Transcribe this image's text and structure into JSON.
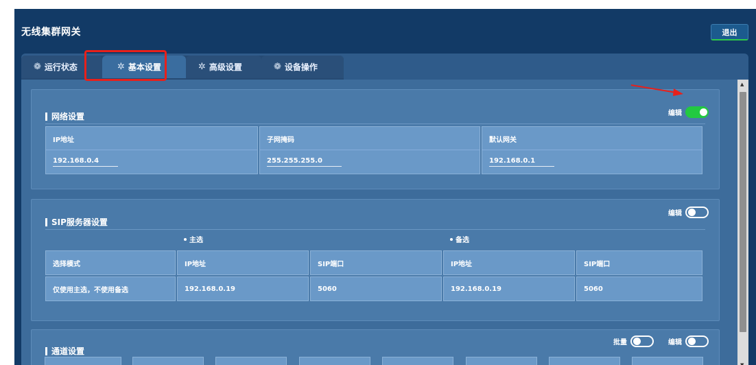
{
  "app": {
    "title": "无线集群网关",
    "logout_label": "退出"
  },
  "tabs": [
    {
      "label": "运行状态",
      "icon": "gear-icon"
    },
    {
      "label": "基本设置",
      "icon": "asterisk-icon",
      "active": true
    },
    {
      "label": "高级设置",
      "icon": "asterisk-icon"
    },
    {
      "label": "设备操作",
      "icon": "gear-icon"
    }
  ],
  "network": {
    "title": "网络设置",
    "edit_label": "编辑",
    "edit_on": true,
    "ip_label": "IP地址",
    "ip_value": "192.168.0.4",
    "mask_label": "子网掩码",
    "mask_value": "255.255.255.0",
    "gateway_label": "默认网关",
    "gateway_value": "192.168.0.1"
  },
  "sip": {
    "title": "SIP服务器设置",
    "edit_label": "编辑",
    "edit_on": false,
    "primary_label": "主选",
    "backup_label": "备选",
    "mode_label": "选择模式",
    "mode_value": "仅使用主选，不使用备选",
    "primary_ip_label": "IP地址",
    "primary_ip_value": "192.168.0.19",
    "primary_port_label": "SIP端口",
    "primary_port_value": "5060",
    "backup_ip_label": "IP地址",
    "backup_ip_value": "192.168.0.19",
    "backup_port_label": "SIP端口",
    "backup_port_value": "5060"
  },
  "channel": {
    "title": "通道设置",
    "batch_label": "批量",
    "batch_on": false,
    "edit_label": "编辑",
    "edit_on": false
  },
  "colors": {
    "accent_green": "#22c940",
    "annotation_red": "#e8201a",
    "bg_navy": "#123a66"
  }
}
